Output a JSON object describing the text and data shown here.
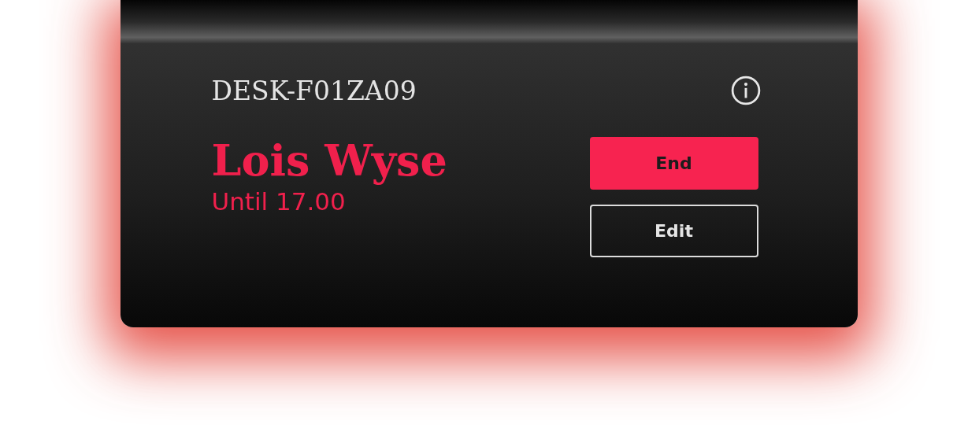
{
  "desk": {
    "title": "DESK-F01ZA09"
  },
  "booking": {
    "name": "Lois Wyse",
    "until": "Until 17.00"
  },
  "buttons": [
    {
      "label": "End",
      "kind": "primary"
    },
    {
      "label": "Edit",
      "kind": "outline"
    }
  ]
}
